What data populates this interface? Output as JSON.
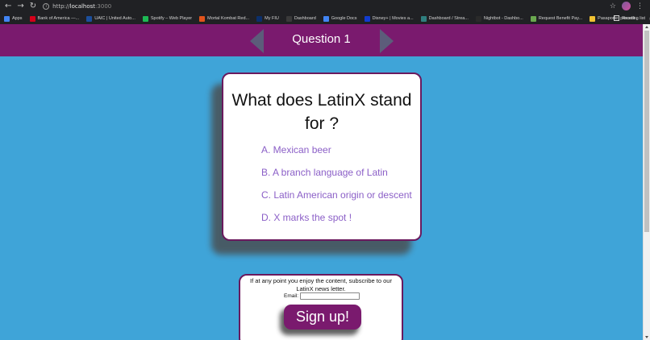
{
  "browser": {
    "url_host": "localhost",
    "url_port": ":3000",
    "url_scheme": "http://",
    "bookmarks": [
      {
        "label": "Apps",
        "color": "#4285f4"
      },
      {
        "label": "Bank of America —...",
        "color": "#d4001a"
      },
      {
        "label": "UAIC | United Auto...",
        "color": "#1c4f9c"
      },
      {
        "label": "Spotify – Web Player",
        "color": "#1db954"
      },
      {
        "label": "Mortal Kombat Red...",
        "color": "#e2531b"
      },
      {
        "label": "My FIU",
        "color": "#0b2f6b"
      },
      {
        "label": "Dashboard",
        "color": "#3a3a3a"
      },
      {
        "label": "Google Docs",
        "color": "#4285f4"
      },
      {
        "label": "Disney+ | Movies a...",
        "color": "#113ccf"
      },
      {
        "label": "Dashboard / Strea...",
        "color": "#2f7f7f"
      },
      {
        "label": "Nightbot - Dashbo...",
        "color": "#2a2a2a"
      },
      {
        "label": "Request Benefit Pay...",
        "color": "#6aa84f"
      },
      {
        "label": "Pasaporte: procedi...",
        "color": "#f1c232"
      }
    ],
    "more_label": "»",
    "reading_list": "Reading list"
  },
  "header": {
    "title": "Question 1",
    "background": "#7a1a6e"
  },
  "question": {
    "text": "What does LatinX stand for ?",
    "answers": [
      "A. Mexican beer",
      "B. A branch language of Latin",
      "C. Latin American origin or descent",
      "D. X marks the spot !"
    ],
    "answer_color": "#8b5fc7"
  },
  "subscribe": {
    "message": "If at any point you enjoy the content, subscribe to our LatinX news letter.",
    "email_label": "Email:",
    "email_value": "",
    "button_label": "Sign up!"
  }
}
